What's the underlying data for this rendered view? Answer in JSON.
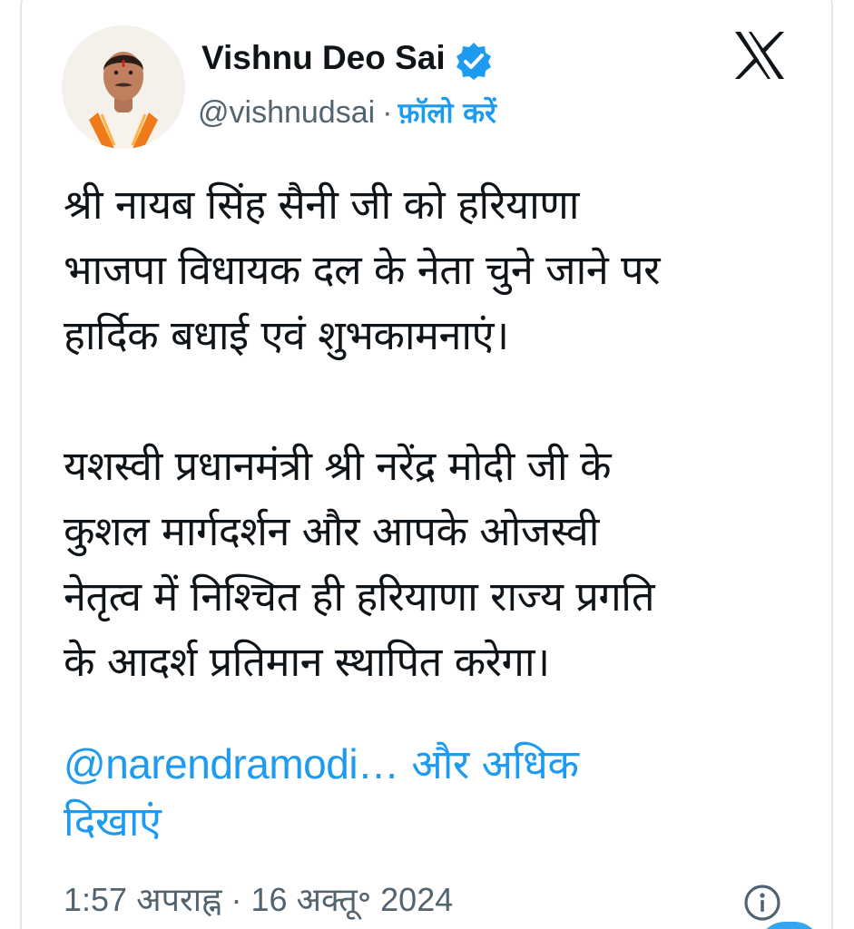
{
  "author": {
    "display_name": "Vishnu Deo Sai",
    "handle": "@vishnudsai",
    "separator": "·",
    "follow_label": "फ़ॉलो करें",
    "verified_icon": "verified-badge-icon",
    "avatar_icon": "profile-avatar"
  },
  "platform": {
    "logo_icon": "x-logo-icon"
  },
  "tweet": {
    "lines": [
      "श्री नायब सिंह सैनी जी को हरियाणा",
      "भाजपा विधायक दल के नेता चुने जाने पर",
      "हार्दिक बधाई एवं शुभकामनाएं।",
      "यशस्वी प्रधानमंत्री श्री नरेंद्र मोदी जी के",
      "कुशल मार्गदर्शन और आपके ओजस्वी",
      "नेतृत्व में निश्चित ही हरियाणा राज्य प्रगति",
      "के आदर्श प्रतिमान स्थापित करेगा।"
    ],
    "mention": "@narendramodi…",
    "show_more_part1": "और अधिक",
    "show_more_part2": "दिखाएं"
  },
  "meta": {
    "timestamp": "1:57 अपराह्न · 16 अक्तू॰ 2024",
    "info_icon": "info-icon"
  },
  "colors": {
    "text": "#0f1419",
    "secondary": "#536471",
    "accent": "#1d9bf0",
    "border": "#e3e7ea"
  }
}
